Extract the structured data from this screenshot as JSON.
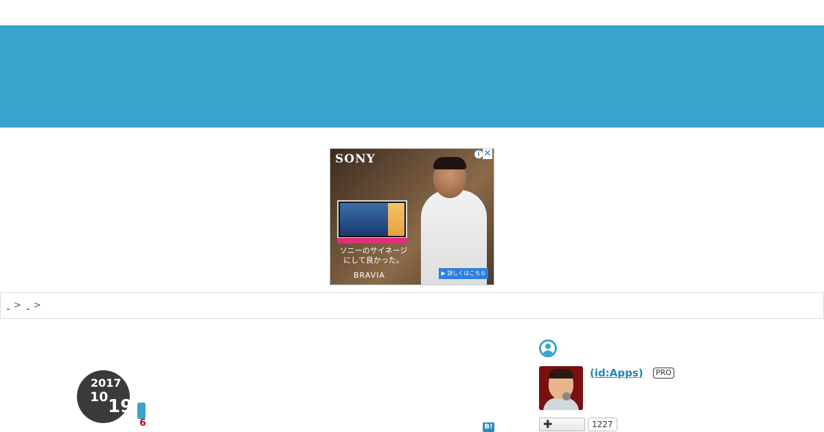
{
  "header": {
    "color": "#38a3cc"
  },
  "ad": {
    "brand": "SONY",
    "info_icon": "info-icon",
    "close_icon": "close-icon",
    "copy_line1": "ソニーのサイネージ",
    "copy_line2": "にして良かった。",
    "product": "BRAVIA",
    "cta": "▶ 詳しくはこちら"
  },
  "breadcrumb": {
    "separator": ">"
  },
  "entry": {
    "year": "2017",
    "month": "10",
    "day": "19",
    "star_count": "6",
    "hatena_bookmark": "B!"
  },
  "profile": {
    "username": " (id:Apps)",
    "badge": "PRO",
    "follow_icon": "plus-icon",
    "follower_count": "1227"
  }
}
